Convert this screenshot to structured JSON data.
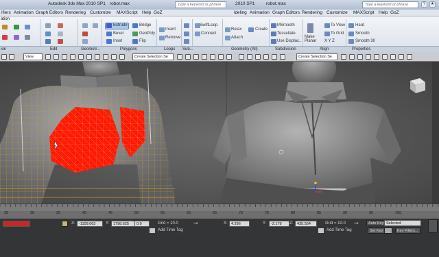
{
  "titlebar": {
    "left_title": "Autodesk 3ds Max  2010 SP1",
    "left_file": "robot.max",
    "right_title_prefix": "2010 SP1",
    "right_file": "robot.max",
    "search_placeholder": "Type a keyword or phrase"
  },
  "menus_left": [
    "ifiers",
    "Animation",
    "Graph Editors",
    "Rendering",
    "Customize",
    "MAXScript",
    "Help",
    "GoZ"
  ],
  "menus_right": [
    "ideling",
    "Animation",
    "Graph Editors",
    "Rendering",
    "Customize",
    "MAXScript",
    "Help",
    "GoZ"
  ],
  "ribbon": {
    "top_left_label": "ation",
    "polygons": {
      "extrude": "Extrude",
      "bevel": "Bevel",
      "inset": "Inset",
      "bridge": "Bridge",
      "geopoly": "GeoPoly",
      "flip": "Flip"
    },
    "loops": {
      "insert": "Insert",
      "remove": "Remove"
    },
    "sub": {
      "swiftloop": "SwiftLoop",
      "connect": "Connect"
    },
    "geometry": {
      "relax": "Relax",
      "attach": "Attach",
      "create": "Create"
    },
    "subdivision": {
      "msmooth": "MSmooth",
      "tessellate": "Tessellate",
      "use_displac": "Use Displac..."
    },
    "align": {
      "make_planar": "Make Planar",
      "to_view": "To View",
      "to_grid": "To Grid",
      "xyz": "X Y Z"
    },
    "properties": {
      "hard": "Hard",
      "smooth": "Smooth",
      "smooth30": "Smooth 30"
    },
    "footer": [
      "ion",
      "Edit",
      "Geometr...",
      "Polygons",
      "Loops",
      "Sub...",
      "Geometry (All)",
      "Subdivision",
      "Align",
      "Properties"
    ]
  },
  "vp_toolbar": {
    "view_dropdown": "View",
    "selection_set_left": "Create Selection Se",
    "selection_set_right": "Create Selection Se"
  },
  "timeline": {
    "ticks": [
      "25",
      "30",
      "35",
      "40",
      "45",
      "50",
      "55",
      "60",
      "65",
      "70",
      "75",
      "80",
      "85",
      "90",
      "95",
      "100"
    ]
  },
  "status": {
    "x_label": "X:",
    "x_left": "-1109.063",
    "y_label": "Y:",
    "y_left": "1798.625",
    "z_label": "Z:",
    "z_left": "0.0",
    "grid_left": "Grid = 10.0",
    "add_time_tag": "Add Time Tag",
    "x_right": "4.296",
    "y_right": "-2.179",
    "z_right": "435.554",
    "grid_right": "Grid = 10.0",
    "auto_key": "Auto Key",
    "selected": "Selected",
    "set_key": "Set Key",
    "key_filters": "Key Filters..."
  },
  "colors": {
    "viewport_bg": "#5a5a5a",
    "selection_red": "#ff1a00",
    "wire_orange": "#e0a020",
    "highlight_blue": "#a9c8ef"
  }
}
